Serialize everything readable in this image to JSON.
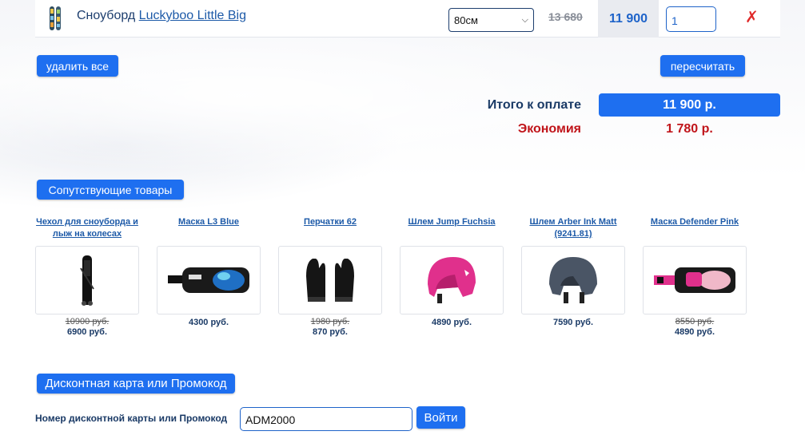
{
  "cart": {
    "item": {
      "prefix": "Сноуборд",
      "name_link": "Luckyboo Little Big",
      "size_selected": "80см",
      "old_price": "13 680",
      "price": "11 900",
      "qty": "1",
      "remove": "✗"
    },
    "delete_all": "удалить все",
    "recalculate": "пересчитать"
  },
  "totals": {
    "total_label": "Итого к оплате",
    "total_value": "11 900 р.",
    "economy_label": "Экономия",
    "economy_value": "1 780 р."
  },
  "related": {
    "title": "Сопутствующие товары",
    "products": [
      {
        "name": "Чехол для сноуборда и лыж на колесах",
        "old_price": "10900 руб.",
        "price": "6900 руб.",
        "icon": "board-bag-icon"
      },
      {
        "name": "Маска L3 Blue",
        "old_price": "",
        "price": "4300 руб.",
        "icon": "goggles-icon"
      },
      {
        "name": "Перчатки 62",
        "old_price": "1980 руб.",
        "price": "870 руб.",
        "icon": "gloves-icon"
      },
      {
        "name": "Шлем Jump Fuchsia",
        "old_price": "",
        "price": "4890 руб.",
        "icon": "helmet-icon"
      },
      {
        "name": "Шлем Arber Ink Matt (9241.81)",
        "old_price": "",
        "price": "7590 руб.",
        "icon": "helmet-icon"
      },
      {
        "name": "Маска Defender Pink",
        "old_price": "8550 руб.",
        "price": "4890 руб.",
        "icon": "goggles-icon"
      }
    ]
  },
  "discount": {
    "title": "Дисконтная карта или Промокод",
    "label": "Номер дисконтной карты или Промокод",
    "value": "ADM2000",
    "apply": "Войти"
  },
  "colors": {
    "accent": "#1e6ff0",
    "text": "#1a3a66",
    "economy": "#c0141a"
  }
}
